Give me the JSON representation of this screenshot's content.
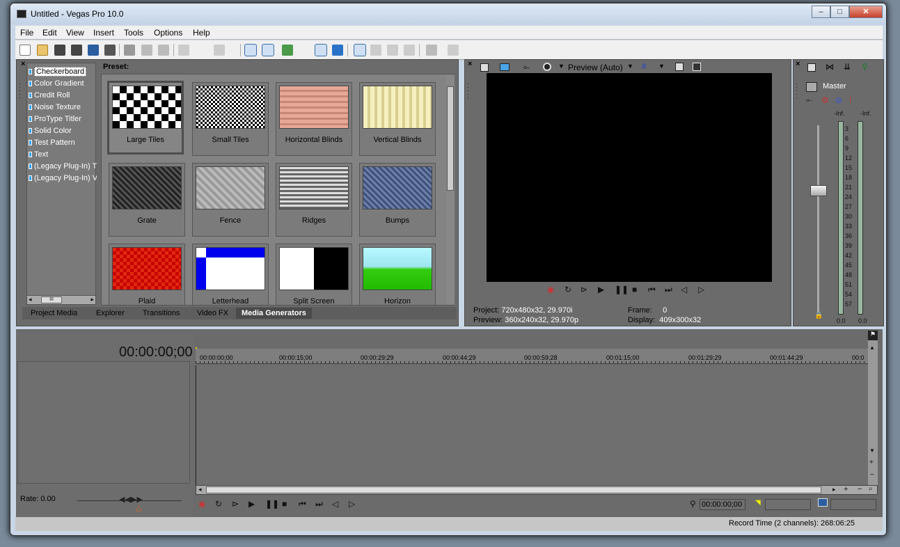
{
  "window": {
    "title": "Untitled - Vegas Pro 10.0",
    "min": "–",
    "max": "□",
    "close": "✕"
  },
  "menu": [
    "File",
    "Edit",
    "View",
    "Insert",
    "Tools",
    "Options",
    "Help"
  ],
  "media_generators": {
    "tree": [
      "Checkerboard",
      "Color Gradient",
      "Credit Roll",
      "Noise Texture",
      "ProType Titler",
      "Solid Color",
      "Test Pattern",
      "Text",
      "(Legacy Plug-In) T",
      "(Legacy Plug-In) V"
    ],
    "preset_label": "Preset:",
    "presets": [
      "Large Tiles",
      "Small Tiles",
      "Horizontal Blinds",
      "Vertical Blinds",
      "Grate",
      "Fence",
      "Ridges",
      "Bumps",
      "Plaid",
      "Letterhead",
      "Split Screen",
      "Horizon"
    ],
    "tabs": [
      "Project Media",
      "Explorer",
      "Transitions",
      "Video FX",
      "Media Generators"
    ],
    "scroll_thumb": "III"
  },
  "preview": {
    "mode": "Preview (Auto)",
    "project_label": "Project:",
    "project_value": "720x480x32, 29.970i",
    "preview_label": "Preview:",
    "preview_value": "360x240x32, 29.970p",
    "frame_label": "Frame:",
    "frame_value": "0",
    "display_label": "Display:",
    "display_value": "409x300x32"
  },
  "mixer": {
    "master": "Master",
    "inf_left": "-Inf.",
    "inf_right": "-Inf.",
    "scale": [
      "3",
      "6",
      "9",
      "12",
      "15",
      "18",
      "21",
      "24",
      "27",
      "30",
      "33",
      "36",
      "39",
      "42",
      "45",
      "48",
      "51",
      "54",
      "57"
    ],
    "val_left": "0.0",
    "val_right": "0.0"
  },
  "timeline": {
    "timecode": "00:00:00;00",
    "ruler": [
      "00:00:00;00",
      "00:00:15;00",
      "00:00:29;29",
      "00:00:44;29",
      "00:00:59;28",
      "00:01:15;00",
      "00:01:29;29",
      "00:01:44;29",
      "00:0"
    ],
    "rate": "Rate: 0.00",
    "cursor_time": "00:00:00;00"
  },
  "status": {
    "record_time": "Record Time (2 channels): 268:06:25"
  }
}
